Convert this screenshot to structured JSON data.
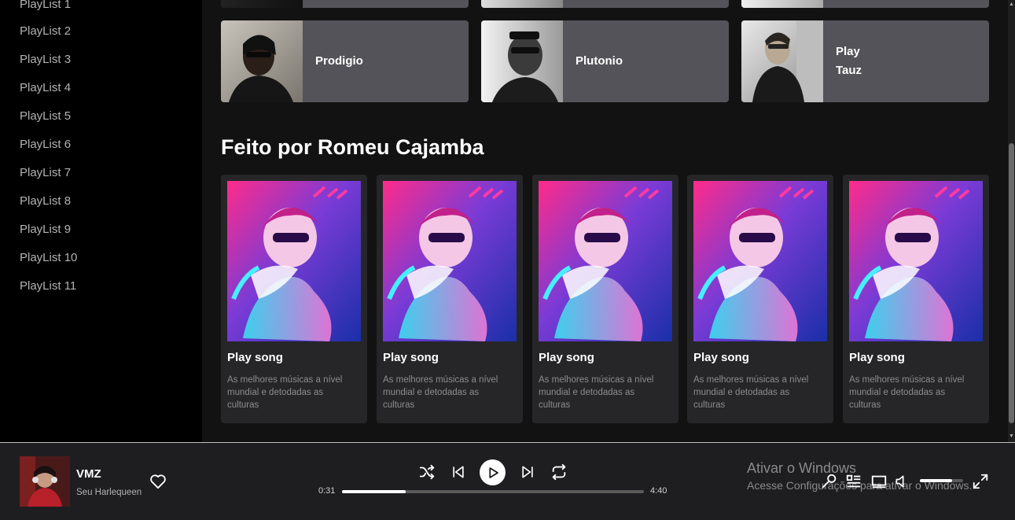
{
  "sidebar": {
    "items": [
      {
        "label": "PlayList 1"
      },
      {
        "label": "PlayList 2"
      },
      {
        "label": "PlayList 3"
      },
      {
        "label": "PlayList 4"
      },
      {
        "label": "PlayList 5"
      },
      {
        "label": "PlayList 6"
      },
      {
        "label": "PlayList 7"
      },
      {
        "label": "PlayList 8"
      },
      {
        "label": "PlayList 9"
      },
      {
        "label": "PlayList 10"
      },
      {
        "label": "PlayList 11"
      }
    ]
  },
  "tiles": [
    {
      "label": "Prodigio"
    },
    {
      "label": "Plutonio"
    },
    {
      "label_line1": "Play",
      "label_line2": "Tauz"
    }
  ],
  "section": {
    "title": "Feito por Romeu Cajamba",
    "cards": [
      {
        "title": "Play song",
        "description": "As melhores músicas a nível mundial e detodadas as culturas"
      },
      {
        "title": "Play song",
        "description": "As melhores músicas a nível mundial e detodadas as culturas"
      },
      {
        "title": "Play song",
        "description": "As melhores músicas a nível mundial e detodadas as culturas"
      },
      {
        "title": "Play song",
        "description": "As melhores músicas a nível mundial e detodadas as culturas"
      },
      {
        "title": "Play song",
        "description": "As melhores músicas a nível mundial e detodadas as culturas"
      }
    ]
  },
  "player": {
    "track_title": "VMZ",
    "artist": "Seu Harlequeen",
    "current_time": "0:31",
    "total_time": "4:40",
    "progress": 0.21,
    "volume": 0.75,
    "icons": [
      "heart-icon",
      "shuffle-icon",
      "previous-icon",
      "play-icon",
      "next-icon",
      "repeat-icon",
      "microphone-icon",
      "queue-icon",
      "device-icon",
      "volume-icon",
      "fullscreen-icon"
    ]
  },
  "watermark": {
    "title": "Ativar o Windows",
    "subtitle": "Acesse Configurações para ativar o Windows."
  },
  "colors": {
    "background": "#121212",
    "sidebar": "#000000",
    "tile": "#535359",
    "card": "#262629",
    "player": "#1e1e21"
  }
}
